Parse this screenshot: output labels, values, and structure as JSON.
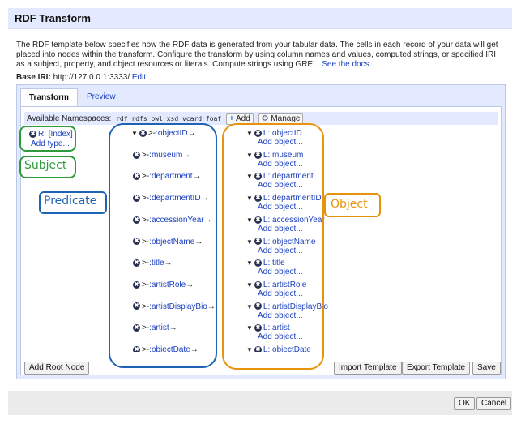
{
  "dialog": {
    "title": "RDF Transform",
    "description_1": "The RDF template below specifies how the RDF data is generated from your tabular data. The cells in each record of your data will get placed into nodes within the transform. Configure the transform by using column names and values, computed strings, or specified IRI as a subject, property, and object resources or literals. Compute strings using GREL.",
    "docs_link": "See the docs.",
    "base_iri_label": "Base IRI:",
    "base_iri_value": "http://127.0.0.1:3333/",
    "base_iri_edit": "Edit"
  },
  "tabs": [
    {
      "label": "Transform",
      "active": true
    },
    {
      "label": "Preview",
      "active": false
    }
  ],
  "namespaces": {
    "label": "Available Namespaces:",
    "list": "rdf rdfs owl xsd vcard foaf",
    "add_button": "Add",
    "manage_button": "Manage"
  },
  "subject": {
    "label": "R: [Index]",
    "add_type": "Add type..."
  },
  "rows": [
    {
      "predicate": ":objectID",
      "object": "L: objectID",
      "add": "Add object..."
    },
    {
      "predicate": ":museum",
      "object": "L: museum",
      "add": "Add object..."
    },
    {
      "predicate": ":department",
      "object": "L: department",
      "add": "Add object..."
    },
    {
      "predicate": ":departmentID",
      "object": "L: departmentID",
      "add": "Add object..."
    },
    {
      "predicate": ":accessionYear",
      "object": "L: accessionYear",
      "add": "Add object..."
    },
    {
      "predicate": ":objectName",
      "object": "L: objectName",
      "add": "Add object..."
    },
    {
      "predicate": ":title",
      "object": "L: title",
      "add": "Add object..."
    },
    {
      "predicate": ":artistRole",
      "object": "L: artistRole",
      "add": "Add object..."
    },
    {
      "predicate": ":artistDisplayBio",
      "object": "L: artistDisplayBio",
      "add": "Add object..."
    },
    {
      "predicate": ":artist",
      "object": "L: artist",
      "add": "Add object..."
    },
    {
      "predicate": ":objectDate",
      "object": "L: objectDate",
      "add": "Add object"
    }
  ],
  "bottom_buttons": {
    "add_root": "Add Root Node",
    "import": "Import Template",
    "export": "Export Template",
    "save": "Save"
  },
  "footer_buttons": {
    "ok": "OK",
    "cancel": "Cancel"
  },
  "annotations": {
    "subject": "Subject",
    "predicate": "Predicate",
    "object": "Object",
    "subject_color": "#2e9a3c",
    "predicate_color": "#1f63b5",
    "object_color": "#e8930c"
  },
  "icons": {
    "arrow": "→",
    "triangle": "▼",
    "remove": "✖",
    "add": "+"
  }
}
